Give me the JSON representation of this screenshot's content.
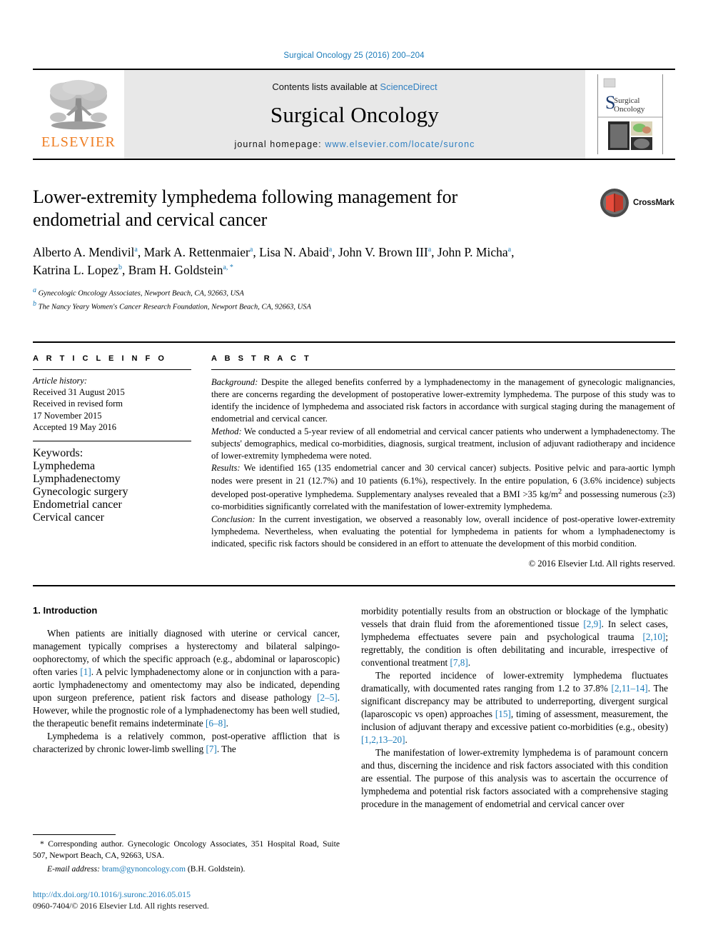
{
  "running_head": "Surgical Oncology 25 (2016) 200–204",
  "journal_header": {
    "publisher_name": "ELSEVIER",
    "contents_prefix": "Contents lists available at ",
    "contents_link": "ScienceDirect",
    "journal_name": "Surgical Oncology",
    "homepage_label": "journal homepage: ",
    "homepage_url": "www.elsevier.com/locate/suronc",
    "cover_title_line1": "Surgical",
    "cover_title_line2": "Oncology"
  },
  "article": {
    "title": "Lower-extremity lymphedema following management for endometrial and cervical cancer",
    "crossmark_label": "CrossMark",
    "authors_line1_parts": [
      {
        "name": "Alberto A. Mendivil",
        "sup": "a",
        "sep": ", "
      },
      {
        "name": "Mark A. Rettenmaier",
        "sup": "a",
        "sep": ", "
      },
      {
        "name": "Lisa N. Abaid",
        "sup": "a",
        "sep": ", "
      },
      {
        "name": "John V. Brown III",
        "sup": "a",
        "sep": ","
      }
    ],
    "authors_line2_parts": [
      {
        "name": "John P. Micha",
        "sup": "a",
        "sep": ", "
      },
      {
        "name": "Katrina L. Lopez",
        "sup": "b",
        "sep": ", "
      },
      {
        "name": "Bram H. Goldstein",
        "sup": "a, *",
        "sep": ""
      }
    ],
    "affiliations": [
      {
        "marker": "a",
        "text": "Gynecologic Oncology Associates, Newport Beach, CA, 92663, USA"
      },
      {
        "marker": "b",
        "text": "The Nancy Yeary Women's Cancer Research Foundation, Newport Beach, CA, 92663, USA"
      }
    ]
  },
  "article_info": {
    "heading": "A R T I C L E   I N F O",
    "history_title": "Article history:",
    "history_lines": [
      "Received 31 August 2015",
      "Received in revised form",
      "17 November 2015",
      "Accepted 19 May 2016"
    ],
    "keywords_title": "Keywords:",
    "keywords": [
      "Lymphedema",
      "Lymphadenectomy",
      "Gynecologic surgery",
      "Endometrial cancer",
      "Cervical cancer"
    ]
  },
  "abstract": {
    "heading": "A B S T R A C T",
    "background_label": "Background:",
    "background_text": " Despite the alleged benefits conferred by a lymphadenectomy in the management of gynecologic malignancies, there are concerns regarding the development of postoperative lower-extremity lymphedema. The purpose of this study was to identify the incidence of lymphedema and associated risk factors in accordance with surgical staging during the management of endometrial and cervical cancer.",
    "method_label": "Method:",
    "method_text": " We conducted a 5-year review of all endometrial and cervical cancer patients who underwent a lymphadenectomy. The subjects' demographics, medical co-morbidities, diagnosis, surgical treatment, inclusion of adjuvant radiotherapy and incidence of lower-extremity lymphedema were noted.",
    "results_label": "Results:",
    "results_text_a": " We identified 165 (135 endometrial cancer and 30 cervical cancer) subjects. Positive pelvic and para-aortic lymph nodes were present in 21 (12.7%) and 10 patients (6.1%), respectively. In the entire population, 6 (3.6% incidence) subjects developed post-operative lymphedema. Supplementary analyses revealed that a BMI >35 kg/m",
    "results_sup": "2",
    "results_text_b": " and possessing numerous (≥3) co-morbidities significantly correlated with the manifestation of lower-extremity lymphedema.",
    "conclusion_label": "Conclusion:",
    "conclusion_text": " In the current investigation, we observed a reasonably low, overall incidence of post-operative lower-extremity lymphedema. Nevertheless, when evaluating the potential for lymphedema in patients for whom a lymphadenectomy is indicated, specific risk factors should be considered in an effort to attenuate the development of this morbid condition.",
    "copyright": "© 2016 Elsevier Ltd. All rights reserved."
  },
  "introduction": {
    "heading": "1. Introduction",
    "left_paragraphs": [
      {
        "segments": [
          {
            "t": "When patients are initially diagnosed with uterine or cervical cancer, management typically comprises a hysterectomy and bilateral salpingo-oophorectomy, of which the specific approach (e.g., abdominal or laparoscopic) often varies ",
            "type": "text"
          },
          {
            "t": "[1]",
            "type": "ref"
          },
          {
            "t": ". A pelvic lymphadenectomy alone or in conjunction with a para-aortic lymphadenectomy and omentectomy may also be indicated, depending upon surgeon preference, patient risk factors and disease pathology ",
            "type": "text"
          },
          {
            "t": "[2–5]",
            "type": "ref"
          },
          {
            "t": ". However, while the prognostic role of a lymphadenectomy has been well studied, the therapeutic benefit remains indeterminate ",
            "type": "text"
          },
          {
            "t": "[6–8]",
            "type": "ref"
          },
          {
            "t": ".",
            "type": "text"
          }
        ]
      },
      {
        "segments": [
          {
            "t": "Lymphedema is a relatively common, post-operative affliction that is characterized by chronic lower-limb swelling ",
            "type": "text"
          },
          {
            "t": "[7]",
            "type": "ref"
          },
          {
            "t": ". The",
            "type": "text"
          }
        ]
      }
    ],
    "right_paragraphs": [
      {
        "indent": false,
        "segments": [
          {
            "t": "morbidity potentially results from an obstruction or blockage of the lymphatic vessels that drain fluid from the aforementioned tissue ",
            "type": "text"
          },
          {
            "t": "[2,9]",
            "type": "ref"
          },
          {
            "t": ". In select cases, lymphedema effectuates severe pain and psychological trauma ",
            "type": "text"
          },
          {
            "t": "[2,10]",
            "type": "ref"
          },
          {
            "t": "; regrettably, the condition is often debilitating and incurable, irrespective of conventional treatment ",
            "type": "text"
          },
          {
            "t": "[7,8]",
            "type": "ref"
          },
          {
            "t": ".",
            "type": "text"
          }
        ]
      },
      {
        "indent": true,
        "segments": [
          {
            "t": "The reported incidence of lower-extremity lymphedema fluctuates dramatically, with documented rates ranging from 1.2 to 37.8% ",
            "type": "text"
          },
          {
            "t": "[2,11–14]",
            "type": "ref"
          },
          {
            "t": ". The significant discrepancy may be attributed to underreporting, divergent surgical (laparoscopic vs open) approaches ",
            "type": "text"
          },
          {
            "t": "[15]",
            "type": "ref"
          },
          {
            "t": ", timing of assessment, measurement, the inclusion of adjuvant therapy and excessive patient co-morbidities (e.g., obesity) ",
            "type": "text"
          },
          {
            "t": "[1,2,13–20]",
            "type": "ref"
          },
          {
            "t": ".",
            "type": "text"
          }
        ]
      },
      {
        "indent": true,
        "segments": [
          {
            "t": "The manifestation of lower-extremity lymphedema is of paramount concern and thus, discerning the incidence and risk factors associated with this condition are essential. The purpose of this analysis was to ascertain the occurrence of lymphedema and potential risk factors associated with a comprehensive staging procedure in the management of endometrial and cervical cancer over",
            "type": "text"
          }
        ]
      }
    ]
  },
  "footnotes": {
    "corresponding_marker": "*",
    "corresponding_text": " Corresponding author. Gynecologic Oncology Associates, 351 Hospital Road, Suite 507, Newport Beach, CA, 92663, USA.",
    "email_label": "E-mail address:",
    "email_address": "bram@gynoncology.com",
    "email_person": " (B.H. Goldstein).",
    "doi": "http://dx.doi.org/10.1016/j.suronc.2016.05.015",
    "issn_line": "0960-7404/© 2016 Elsevier Ltd. All rights reserved."
  },
  "colors": {
    "link_blue": "#1a7bb9",
    "elsevier_orange": "#ef7d22",
    "header_band_gray": "#e8e8e8"
  }
}
